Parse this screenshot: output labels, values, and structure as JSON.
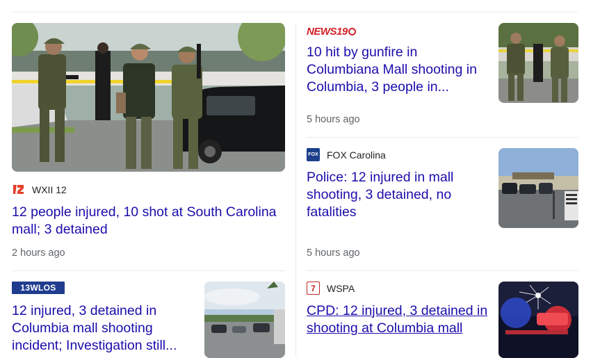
{
  "left_column": {
    "feature": {
      "source": "WXII 12",
      "headline": "12 people injured, 10 shot at South Carolina mall; 3 detained",
      "time": "2 hours ago",
      "image_alt": "armed officers walking in mall parking lot"
    },
    "second": {
      "source_logo_text": "13WLOS",
      "headline": "12 injured, 3 detained in Columbia mall shooting incident; Investigation still...",
      "image_alt": "mall parking lot with police vehicles"
    }
  },
  "right_column": {
    "items": [
      {
        "source_logo_text": "NEWS19",
        "headline": "10 hit by gunfire in Columbiana Mall shooting in Columbia, 3 people in...",
        "time": "5 hours ago",
        "image_alt": "armed officers outside mall"
      },
      {
        "source": "FOX Carolina",
        "headline": "Police: 12 injured in mall shooting, 3 detained, no fatalities",
        "time": "5 hours ago",
        "image_alt": "police vehicles near mall entrance"
      },
      {
        "source": "WSPA",
        "headline": "CPD: 12 injured, 3 detained in shooting at Columbia mall",
        "image_alt": "police lights behind bullet-cracked glass"
      }
    ]
  },
  "colors": {
    "link": "#1a0dab",
    "meta": "#5f6368",
    "divider": "#e8eaed",
    "news19_red": "#d32128",
    "wlos_blue": "#1f3c8f",
    "fox_blue": "#1b3f8b"
  }
}
